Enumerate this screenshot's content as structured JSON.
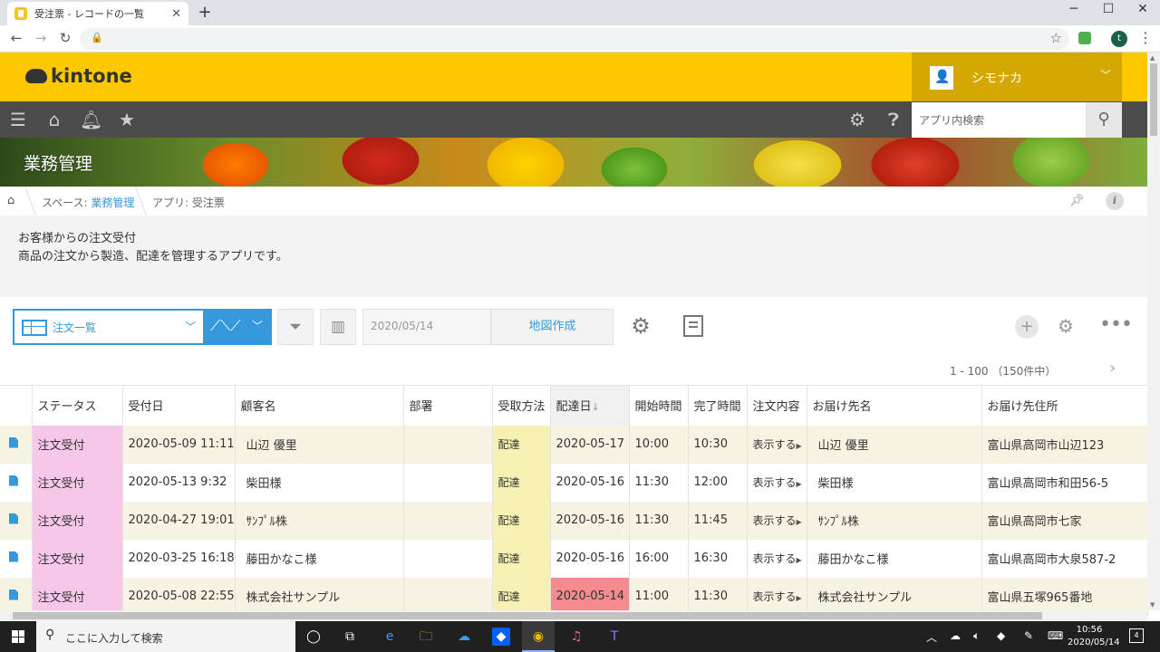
{
  "browser": {
    "tab_title": "受注票 - レコードの一覧",
    "tab_close": "✕",
    "new_tab": "+",
    "win_min": "─",
    "win_max": "☐",
    "win_close": "✕",
    "profile_initial": "t"
  },
  "kintone": {
    "logo": "kintone",
    "user_name": "シモナカ",
    "search_placeholder": "アプリ内検索",
    "space_title": "業務管理",
    "breadcrumb": {
      "space_prefix": "スペース: ",
      "space_name": "業務管理",
      "app_label": "アプリ: 受注票"
    },
    "description": {
      "line1": "お客様からの注文受付",
      "line2": "商品の注文から製造、配達を管理するアプリです。"
    }
  },
  "toolbar": {
    "view_name": "注文一覧",
    "date_filter": "2020/05/14",
    "map_button": "地図作成",
    "pagination": "1 - 100 （150件中）"
  },
  "table": {
    "columns": [
      "",
      "ステータス",
      "受付日",
      "顧客名",
      "部署",
      "受取方法",
      "配達日",
      "開始時間",
      "完了時間",
      "注文内容",
      "お届け先名",
      "お届け先住所"
    ],
    "sort_arrow": "↓",
    "show_label": "表示する",
    "rows": [
      {
        "status": "注文受付",
        "received": "2020-05-09 11:11",
        "customer": "山辺 優里",
        "dept": "",
        "method": "配達",
        "delivery": "2020-05-17",
        "start": "10:00",
        "end": "10:30",
        "dest_name": "山辺 優里",
        "address": "富山県高岡市山辺123",
        "late": false
      },
      {
        "status": "注文受付",
        "received": "2020-05-13 9:32",
        "customer": "柴田様",
        "dept": "",
        "method": "配達",
        "delivery": "2020-05-16",
        "start": "11:30",
        "end": "12:00",
        "dest_name": "柴田様",
        "address": "富山県高岡市和田56-5",
        "late": false
      },
      {
        "status": "注文受付",
        "received": "2020-04-27 19:01",
        "customer": "ｻﾝﾌﾟﾙ株",
        "dept": "",
        "method": "配達",
        "delivery": "2020-05-16",
        "start": "11:30",
        "end": "11:45",
        "dest_name": "ｻﾝﾌﾟﾙ株",
        "address": "富山県高岡市七家",
        "late": false
      },
      {
        "status": "注文受付",
        "received": "2020-03-25 16:18",
        "customer": "藤田かなこ様",
        "dept": "",
        "method": "配達",
        "delivery": "2020-05-16",
        "start": "16:00",
        "end": "16:30",
        "dest_name": "藤田かなこ様",
        "address": "富山県高岡市大泉587-2",
        "late": false
      },
      {
        "status": "注文受付",
        "received": "2020-05-08 22:55",
        "customer": "株式会社サンプル",
        "dept": "",
        "method": "配達",
        "delivery": "2020-05-14",
        "start": "11:00",
        "end": "11:30",
        "dest_name": "株式会社サンプル",
        "address": "富山県五塚965番地",
        "late": true
      }
    ],
    "colors": {
      "status": "#f6c7e8",
      "method": "#f5f1b2",
      "late": "#f58a8f",
      "stripe": "#f7f3e2"
    }
  },
  "taskbar": {
    "search_placeholder": "ここに入力して検索",
    "time": "10:56",
    "date": "2020/05/14",
    "notification_count": "4"
  },
  "colors": {
    "brand_yellow": "#fcc800",
    "accent_blue": "#3498db",
    "toolbar_gray": "#4b4b4b"
  }
}
